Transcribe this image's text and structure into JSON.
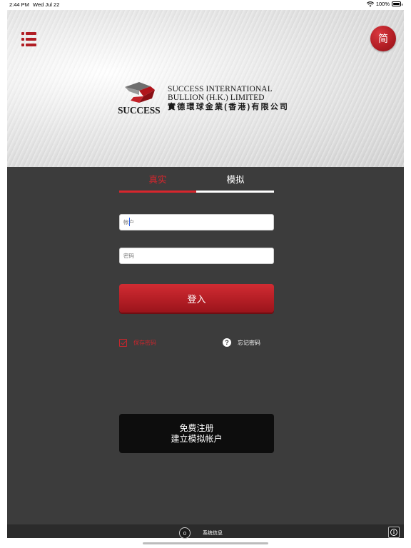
{
  "status_bar": {
    "time": "2:44 PM",
    "date": "Wed Jul 22",
    "battery": "100%"
  },
  "header": {
    "lang_toggle": "简",
    "logo": {
      "wordmark": "SUCCESS",
      "name_en_line1": "SUCCESS INTERNATIONAL",
      "name_en_line2": "BULLION (H.K.) LIMITED",
      "name_zh": "實德環球金業(香港)有限公司"
    }
  },
  "tabs": [
    {
      "label": "真实",
      "active": true
    },
    {
      "label": "模拟",
      "active": false
    }
  ],
  "form": {
    "account_placeholder": "帐户",
    "password_placeholder": "密码",
    "login_label": "登入",
    "remember_label": "保存密码",
    "remember_checked": true,
    "forgot_label": "忘记密码"
  },
  "register": {
    "line1": "免费注册",
    "line2": "建立模拟帐户"
  },
  "footer": {
    "notification_count": "0",
    "system_info_label": "系统信息"
  },
  "colors": {
    "accent": "#d8262d",
    "panel_bg": "#3c3c3c",
    "register_bg": "#0d0d0d"
  }
}
